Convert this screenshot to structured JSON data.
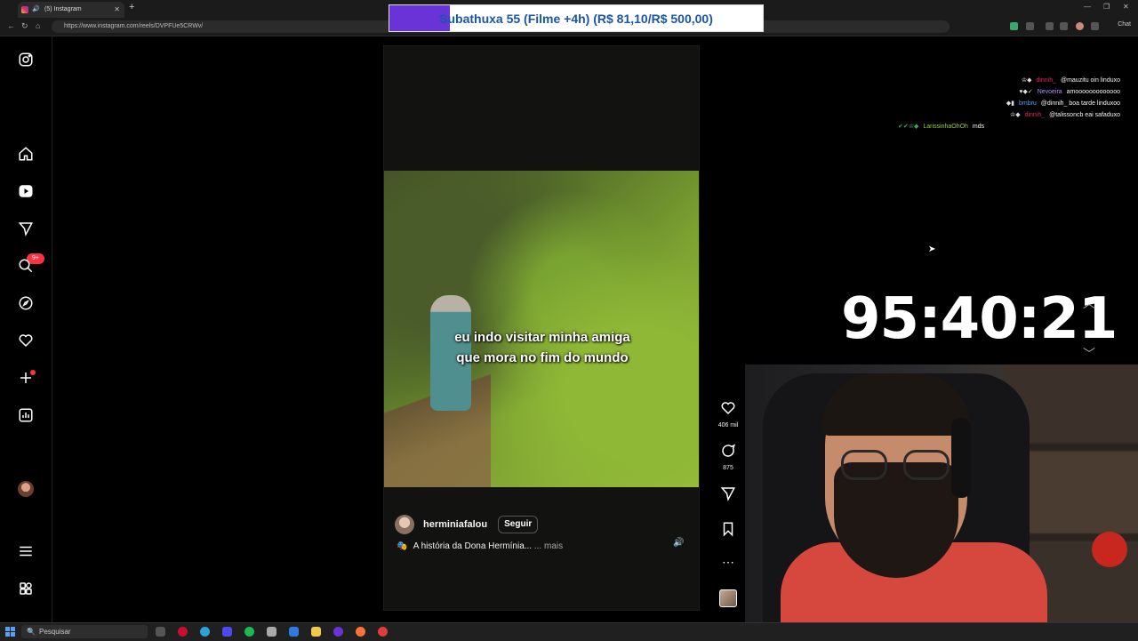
{
  "browser": {
    "tab_title": "(5) Instagram",
    "url": "https://www.instagram.com/reels/DVPFUe5CRWv/",
    "extension_label": "Chat"
  },
  "overlay": {
    "subathon_text": "Subathuxa 55 (Filme +4h) (R$ 81,10/R$ 500,00)",
    "subathon_progress": 0.162,
    "timer": "95:40:21"
  },
  "sidebar": {
    "notification_badge": "9+"
  },
  "reel": {
    "caption_line1": "eu indo visitar minha amiga",
    "caption_line2": "que mora no fim do mundo",
    "username": "herminiafalou",
    "follow_label": "Seguir",
    "description": "A história da Dona Hermínia...",
    "more_label": "... mais",
    "likes": "406 mil",
    "comments": "875"
  },
  "chat": [
    {
      "name": "dinnih_",
      "color": "#e0245e",
      "message": "@mauzitu oin linduxo"
    },
    {
      "name": "Nevoeira",
      "color": "#b48cff",
      "message": "amooooooooooooo"
    },
    {
      "name": "bmbru",
      "color": "#5aa0f0",
      "message": "@dinnih_ boa tarde linduxoo"
    },
    {
      "name": "dinnih_",
      "color": "#e0245e",
      "message": "@talissoncb eai safaduxo"
    },
    {
      "name": "LarissinhaOhOh",
      "color": "#9acd32",
      "message": "mds"
    }
  ],
  "taskbar": {
    "search_placeholder": "Pesquisar"
  },
  "colors": {
    "accent_purple": "#6a33d8",
    "notification_red": "#ff3040"
  }
}
